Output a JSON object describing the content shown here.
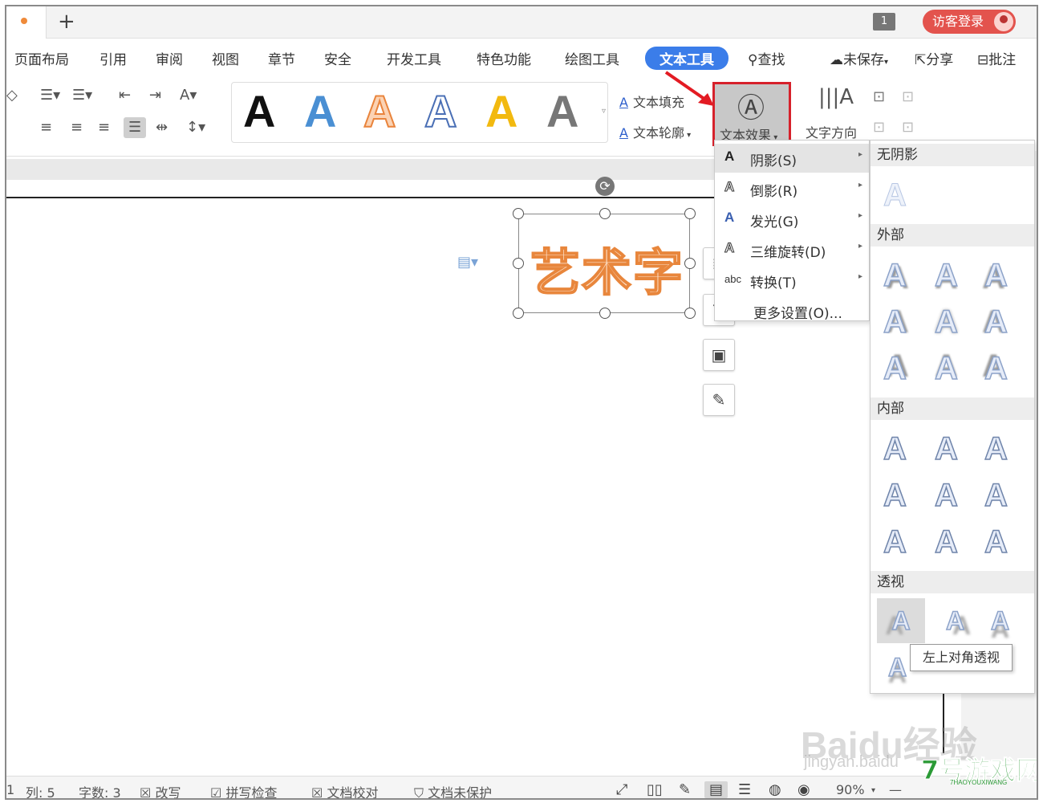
{
  "titlebar": {
    "new_tab": "+",
    "window_count": "1",
    "login": "访客登录"
  },
  "menu": {
    "items": [
      "页面布局",
      "引用",
      "审阅",
      "视图",
      "章节",
      "安全",
      "开发工具",
      "特色功能",
      "绘图工具",
      "文本工具"
    ],
    "active": "文本工具",
    "search": "查找",
    "unsaved": "未保存",
    "share": "分享",
    "comment": "批注"
  },
  "ribbon": {
    "gallery_letter": "A",
    "gallery_colors": [
      "#111111",
      "#4a8fd3",
      "#e9843c",
      "#ffffff",
      "#f2b90f",
      "#777777"
    ],
    "text_fill": "文本填充",
    "text_outline": "文本轮廓",
    "text_effect": "文本效果",
    "text_direction": "文字方向"
  },
  "document": {
    "art_text": "艺术字"
  },
  "effect_menu": {
    "items": [
      {
        "icon": "A",
        "label": "阴影(S)",
        "has_sub": true
      },
      {
        "icon": "A",
        "label": "倒影(R)",
        "has_sub": true
      },
      {
        "icon": "A",
        "label": "发光(G)",
        "has_sub": true
      },
      {
        "icon": "A",
        "label": "三维旋转(D)",
        "has_sub": true
      },
      {
        "icon": "abc",
        "label": "转换(T)",
        "has_sub": true
      },
      {
        "icon": "",
        "label": "更多设置(O)...",
        "has_sub": false
      }
    ]
  },
  "shadow_submenu": {
    "no_shadow": "无阴影",
    "outer": "外部",
    "inner": "内部",
    "perspective": "透视",
    "letter": "A",
    "tooltip": "左上对角透视"
  },
  "statusbar": {
    "col": "列: 5",
    "words": "字数: 3",
    "overwrite": "改写",
    "spellcheck": "拼写检查",
    "proofread": "文档校对",
    "protect": "文档未保护",
    "zoom": "90%",
    "line_prefix": "1"
  },
  "watermarks": {
    "baidu": "Baidu经验",
    "jingyan": "jingyan.baidu",
    "site": "7号游戏网",
    "site_sub": "7HAOYOUXIWANG"
  }
}
